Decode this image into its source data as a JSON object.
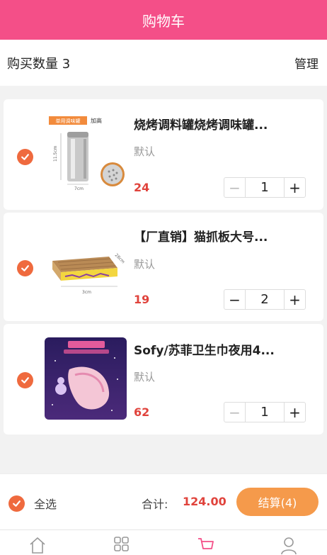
{
  "header": {
    "title": "购物车"
  },
  "subbar": {
    "count_label": "购买数量 3",
    "manage_label": "管理"
  },
  "items": [
    {
      "name": "烧烤调料罐烧烤调味罐...",
      "spec": "默认",
      "price": "24",
      "qty": "1",
      "minus": "−",
      "plus": "+",
      "thumb_texts": {
        "badge": "单用调味罐",
        "tall": "加高",
        "height": "11.5cm",
        "width": "7cm"
      }
    },
    {
      "name": "【厂直销】猫抓板大号...",
      "spec": "默认",
      "price": "19",
      "qty": "2",
      "minus": "−",
      "plus": "+",
      "thumb_texts": {
        "depth": "28cm",
        "length": "3cm"
      }
    },
    {
      "name": "Sofy/苏菲卫生巾夜用4...",
      "spec": "默认",
      "price": "62",
      "qty": "1",
      "minus": "−",
      "plus": "+",
      "thumb_texts": {}
    }
  ],
  "footer": {
    "select_all_label": "全选",
    "total_label": "合计:",
    "total_value": "124.00",
    "checkout_label": "结算(4)"
  },
  "tabs": [
    {
      "icon": "home-icon"
    },
    {
      "icon": "category-grid-icon"
    },
    {
      "icon": "cart-icon"
    },
    {
      "icon": "user-icon"
    }
  ],
  "colors": {
    "brand": "#f44f88",
    "check": "#ef6a3e",
    "price": "#e0433c",
    "checkout": "#f59a4b"
  }
}
